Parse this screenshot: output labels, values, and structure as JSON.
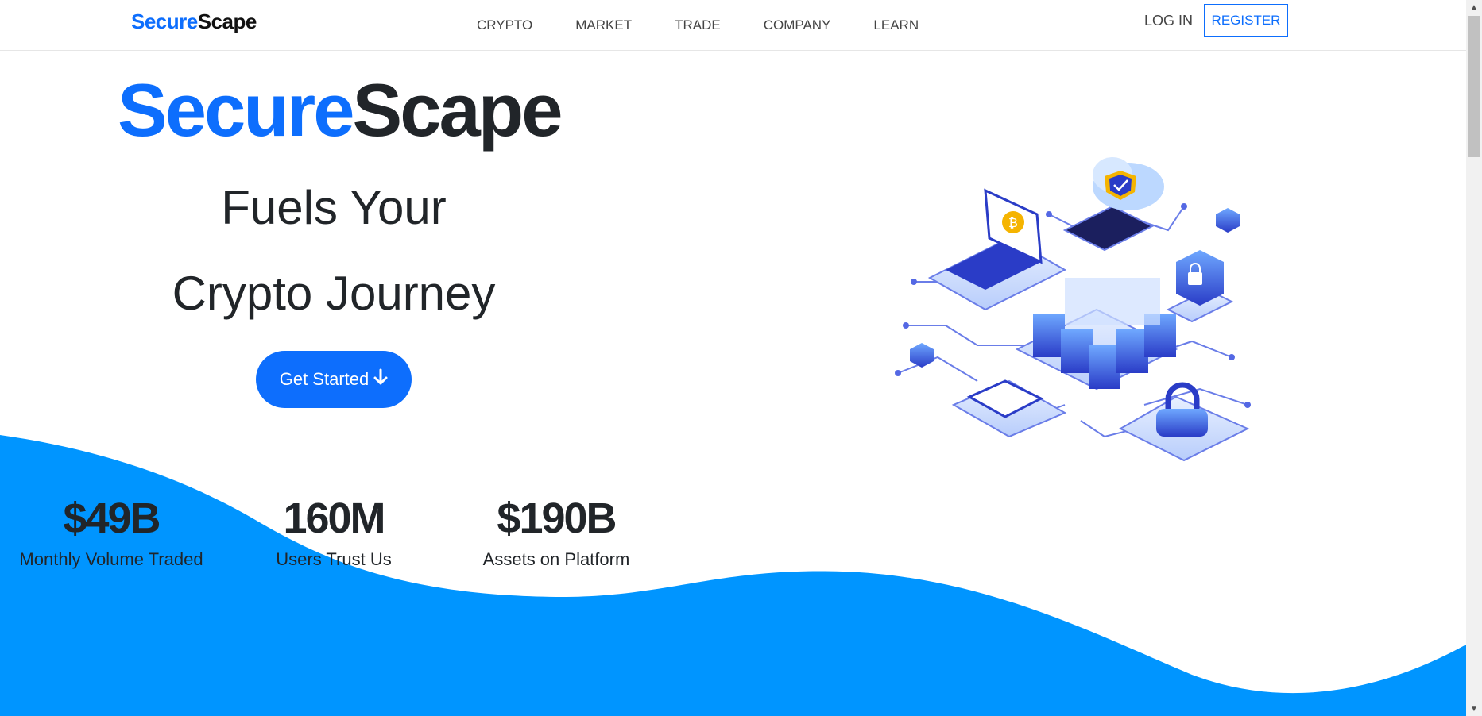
{
  "brand": {
    "part1": "Secure",
    "part2": "Scape"
  },
  "nav": {
    "links": [
      "CRYPTO",
      "MARKET",
      "TRADE",
      "COMPANY",
      "LEARN"
    ],
    "login": "LOG IN",
    "register": "REGISTER"
  },
  "hero": {
    "title_part1": "Secure",
    "title_part2": "Scape",
    "tagline_line1": "Fuels Your",
    "tagline_line2": "Crypto Journey",
    "cta_label": "Get Started",
    "cta_icon": "arrow-down-icon"
  },
  "stats": [
    {
      "value": "$49B",
      "label": "Monthly Volume Traded"
    },
    {
      "value": "160M",
      "label": "Users Trust Us"
    },
    {
      "value": "$190B",
      "label": "Assets on Platform"
    }
  ],
  "colors": {
    "brand_blue": "#0d6efd",
    "wave_blue": "#0095ff",
    "text_dark": "#212529"
  }
}
